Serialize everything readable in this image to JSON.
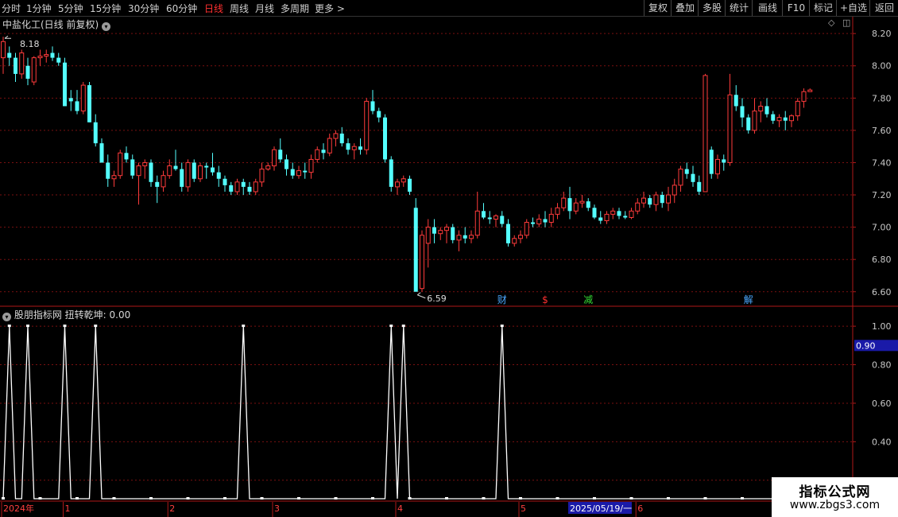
{
  "toolbar": {
    "periods": [
      "分时",
      "1分钟",
      "5分钟",
      "15分钟",
      "30分钟",
      "60分钟",
      "日线",
      "周线",
      "月线",
      "多周期",
      "更多 >"
    ],
    "active_period": "日线",
    "tools": [
      "复权",
      "叠加",
      "多股",
      "统计",
      "画线",
      "F10",
      "标记",
      "+自选",
      "返回"
    ]
  },
  "main_panel": {
    "title": "中盐化工(日线 前复权)",
    "high_label": "8.18",
    "low_label": "6.59"
  },
  "indicator_panel": {
    "title": "股朋指标网 扭转乾坤: 0.00",
    "marker_label": "0.90"
  },
  "event_badges": [
    {
      "label": "财",
      "color": "#4aa8ff",
      "index": 81
    },
    {
      "label": "$",
      "color": "#ff3030",
      "index": 88
    },
    {
      "label": "减",
      "color": "#33dd33",
      "index": 95
    },
    {
      "label": "解",
      "color": "#4aa8ff",
      "index": 121
    }
  ],
  "time_axis": {
    "labels": [
      {
        "text": "2024年",
        "index": 0
      },
      {
        "text": "1",
        "index": 10
      },
      {
        "text": "2",
        "index": 27
      },
      {
        "text": "3",
        "index": 44
      },
      {
        "text": "4",
        "index": 64
      },
      {
        "text": "5",
        "index": 84
      },
      {
        "text": "6",
        "index": 103
      }
    ],
    "cursor_label": {
      "text": "2025/05/19/一",
      "index": 92
    }
  },
  "watermark": {
    "line1": "指标公式网",
    "line2": "www.zbgs3.com"
  },
  "colors": {
    "up": "#ff3b3b",
    "down": "#54ffff",
    "grid": "#7a1010",
    "border": "#b01818",
    "indicator": "#ffffff",
    "axis_text": "#c8c8c8"
  },
  "chart_data": [
    {
      "type": "candlestick",
      "title": "中盐化工(日线 前复权)",
      "ylim": [
        6.52,
        8.26
      ],
      "yticks": [
        6.6,
        6.8,
        7.0,
        7.2,
        7.4,
        7.6,
        7.8,
        8.0,
        8.2
      ],
      "grid": true,
      "ohlc": [
        [
          8.05,
          8.18,
          7.95,
          8.15
        ],
        [
          8.08,
          8.12,
          8.0,
          8.05
        ],
        [
          8.05,
          8.08,
          7.9,
          7.95
        ],
        [
          7.95,
          8.1,
          7.92,
          8.08
        ],
        [
          8.0,
          8.05,
          7.88,
          7.92
        ],
        [
          7.9,
          8.06,
          7.88,
          8.05
        ],
        [
          8.05,
          8.1,
          8.0,
          8.06
        ],
        [
          8.06,
          8.1,
          8.02,
          8.07
        ],
        [
          8.08,
          8.12,
          8.03,
          8.05
        ],
        [
          8.05,
          8.08,
          8.0,
          8.02
        ],
        [
          8.02,
          8.05,
          7.75,
          7.75
        ],
        [
          7.8,
          7.85,
          7.72,
          7.78
        ],
        [
          7.78,
          7.85,
          7.7,
          7.72
        ],
        [
          7.72,
          7.9,
          7.7,
          7.88
        ],
        [
          7.88,
          7.9,
          7.65,
          7.65
        ],
        [
          7.65,
          7.7,
          7.5,
          7.52
        ],
        [
          7.52,
          7.55,
          7.4,
          7.4
        ],
        [
          7.4,
          7.45,
          7.25,
          7.3
        ],
        [
          7.3,
          7.35,
          7.25,
          7.32
        ],
        [
          7.32,
          7.48,
          7.3,
          7.46
        ],
        [
          7.46,
          7.5,
          7.4,
          7.42
        ],
        [
          7.42,
          7.45,
          7.3,
          7.32
        ],
        [
          7.32,
          7.4,
          7.14,
          7.38
        ],
        [
          7.38,
          7.42,
          7.3,
          7.4
        ],
        [
          7.4,
          7.42,
          7.25,
          7.28
        ],
        [
          7.28,
          7.32,
          7.15,
          7.25
        ],
        [
          7.25,
          7.35,
          7.22,
          7.32
        ],
        [
          7.32,
          7.42,
          7.3,
          7.38
        ],
        [
          7.38,
          7.48,
          7.35,
          7.36
        ],
        [
          7.36,
          7.4,
          7.22,
          7.25
        ],
        [
          7.25,
          7.42,
          7.22,
          7.4
        ],
        [
          7.4,
          7.42,
          7.28,
          7.3
        ],
        [
          7.3,
          7.4,
          7.28,
          7.38
        ],
        [
          7.38,
          7.4,
          7.3,
          7.37
        ],
        [
          7.37,
          7.46,
          7.32,
          7.34
        ],
        [
          7.34,
          7.38,
          7.25,
          7.3
        ],
        [
          7.3,
          7.32,
          7.22,
          7.26
        ],
        [
          7.26,
          7.28,
          7.2,
          7.22
        ],
        [
          7.22,
          7.3,
          7.2,
          7.28
        ],
        [
          7.28,
          7.3,
          7.2,
          7.25
        ],
        [
          7.25,
          7.28,
          7.2,
          7.22
        ],
        [
          7.22,
          7.3,
          7.2,
          7.28
        ],
        [
          7.28,
          7.4,
          7.25,
          7.36
        ],
        [
          7.36,
          7.4,
          7.35,
          7.38
        ],
        [
          7.38,
          7.5,
          7.35,
          7.48
        ],
        [
          7.48,
          7.55,
          7.4,
          7.42
        ],
        [
          7.42,
          7.45,
          7.32,
          7.36
        ],
        [
          7.36,
          7.4,
          7.3,
          7.32
        ],
        [
          7.32,
          7.38,
          7.3,
          7.35
        ],
        [
          7.35,
          7.4,
          7.3,
          7.34
        ],
        [
          7.34,
          7.45,
          7.3,
          7.42
        ],
        [
          7.42,
          7.5,
          7.4,
          7.48
        ],
        [
          7.48,
          7.52,
          7.42,
          7.46
        ],
        [
          7.46,
          7.58,
          7.44,
          7.55
        ],
        [
          7.55,
          7.6,
          7.5,
          7.58
        ],
        [
          7.58,
          7.62,
          7.5,
          7.52
        ],
        [
          7.52,
          7.55,
          7.45,
          7.48
        ],
        [
          7.48,
          7.52,
          7.42,
          7.5
        ],
        [
          7.5,
          7.55,
          7.45,
          7.48
        ],
        [
          7.48,
          7.8,
          7.45,
          7.78
        ],
        [
          7.78,
          7.85,
          7.7,
          7.72
        ],
        [
          7.72,
          7.74,
          7.65,
          7.68
        ],
        [
          7.68,
          7.7,
          7.4,
          7.42
        ],
        [
          7.42,
          7.44,
          7.22,
          7.25
        ],
        [
          7.25,
          7.3,
          7.2,
          7.28
        ],
        [
          7.28,
          7.32,
          7.25,
          7.3
        ],
        [
          7.3,
          7.32,
          7.2,
          7.22
        ],
        [
          7.12,
          7.18,
          6.6,
          6.6
        ],
        [
          6.62,
          6.98,
          6.6,
          6.95
        ],
        [
          6.9,
          7.05,
          6.75,
          7.0
        ],
        [
          7.0,
          7.05,
          6.9,
          6.96
        ],
        [
          6.96,
          7.0,
          6.92,
          6.98
        ],
        [
          6.98,
          7.02,
          6.9,
          7.0
        ],
        [
          7.0,
          7.02,
          6.9,
          6.92
        ],
        [
          6.92,
          6.98,
          6.85,
          6.95
        ],
        [
          6.95,
          7.0,
          6.9,
          6.93
        ],
        [
          6.93,
          6.98,
          6.9,
          6.95
        ],
        [
          6.95,
          7.22,
          6.93,
          7.1
        ],
        [
          7.1,
          7.15,
          7.05,
          7.06
        ],
        [
          7.06,
          7.1,
          7.02,
          7.05
        ],
        [
          7.05,
          7.08,
          7.0,
          7.07
        ],
        [
          7.07,
          7.1,
          7.0,
          7.02
        ],
        [
          7.02,
          7.05,
          6.88,
          6.9
        ],
        [
          6.9,
          6.95,
          6.88,
          6.93
        ],
        [
          6.93,
          6.98,
          6.9,
          6.95
        ],
        [
          6.95,
          7.05,
          6.93,
          7.03
        ],
        [
          7.03,
          7.06,
          7.0,
          7.02
        ],
        [
          7.02,
          7.08,
          7.0,
          7.05
        ],
        [
          7.05,
          7.1,
          7.0,
          7.03
        ],
        [
          7.03,
          7.12,
          7.0,
          7.08
        ],
        [
          7.08,
          7.15,
          7.05,
          7.12
        ],
        [
          7.12,
          7.22,
          7.1,
          7.18
        ],
        [
          7.18,
          7.25,
          7.05,
          7.1
        ],
        [
          7.1,
          7.18,
          7.08,
          7.15
        ],
        [
          7.15,
          7.2,
          7.12,
          7.16
        ],
        [
          7.16,
          7.18,
          7.1,
          7.12
        ],
        [
          7.12,
          7.14,
          7.05,
          7.06
        ],
        [
          7.06,
          7.1,
          7.02,
          7.04
        ],
        [
          7.04,
          7.1,
          7.02,
          7.08
        ],
        [
          7.08,
          7.12,
          7.05,
          7.1
        ],
        [
          7.1,
          7.12,
          7.05,
          7.07
        ],
        [
          7.07,
          7.1,
          7.05,
          7.06
        ],
        [
          7.06,
          7.12,
          7.05,
          7.1
        ],
        [
          7.1,
          7.18,
          7.08,
          7.15
        ],
        [
          7.15,
          7.22,
          7.12,
          7.18
        ],
        [
          7.18,
          7.2,
          7.12,
          7.14
        ],
        [
          7.14,
          7.22,
          7.1,
          7.2
        ],
        [
          7.2,
          7.22,
          7.12,
          7.15
        ],
        [
          7.15,
          7.25,
          7.1,
          7.2
        ],
        [
          7.2,
          7.3,
          7.15,
          7.26
        ],
        [
          7.26,
          7.38,
          7.22,
          7.36
        ],
        [
          7.36,
          7.4,
          7.3,
          7.33
        ],
        [
          7.33,
          7.38,
          7.25,
          7.28
        ],
        [
          7.28,
          7.32,
          7.2,
          7.22
        ],
        [
          7.22,
          7.95,
          7.22,
          7.94
        ],
        [
          7.48,
          7.5,
          7.3,
          7.33
        ],
        [
          7.33,
          7.45,
          7.3,
          7.42
        ],
        [
          7.42,
          7.45,
          7.35,
          7.4
        ],
        [
          7.4,
          7.95,
          7.38,
          7.82
        ],
        [
          7.82,
          7.88,
          7.72,
          7.75
        ],
        [
          7.75,
          7.8,
          7.62,
          7.68
        ],
        [
          7.68,
          7.7,
          7.58,
          7.6
        ],
        [
          7.6,
          7.8,
          7.58,
          7.72
        ],
        [
          7.72,
          7.78,
          7.65,
          7.75
        ],
        [
          7.75,
          7.8,
          7.68,
          7.7
        ],
        [
          7.7,
          7.72,
          7.64,
          7.66
        ],
        [
          7.66,
          7.7,
          7.62,
          7.68
        ],
        [
          7.68,
          7.72,
          7.6,
          7.66
        ],
        [
          7.66,
          7.7,
          7.62,
          7.69
        ],
        [
          7.69,
          7.8,
          7.66,
          7.78
        ],
        [
          7.78,
          7.86,
          7.74,
          7.84
        ],
        [
          7.84,
          7.86,
          7.84,
          7.85
        ]
      ]
    },
    {
      "type": "line",
      "title": "扭转乾坤",
      "ylim": [
        0.1,
        1.05
      ],
      "yticks": [
        0.2,
        0.4,
        0.6,
        0.8,
        1.0
      ],
      "series": [
        {
          "name": "扭转乾坤",
          "spike_indices": [
            1,
            4,
            10,
            15,
            39,
            63,
            65,
            81
          ],
          "value_at_spike": 1.0,
          "baseline": 0.0
        }
      ]
    }
  ]
}
